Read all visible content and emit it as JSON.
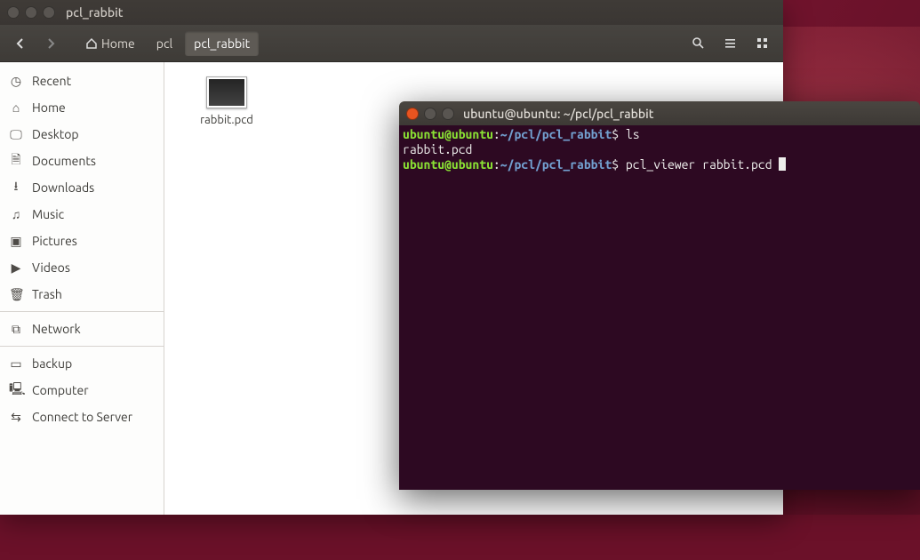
{
  "file_manager": {
    "window_title": "pcl_rabbit",
    "nav": {
      "home_label": "Home",
      "crumbs": [
        "pcl",
        "pcl_rabbit"
      ],
      "active_crumb_index": 1
    },
    "sidebar": {
      "items": [
        {
          "label": "Recent",
          "icon": "clock-icon"
        },
        {
          "label": "Home",
          "icon": "home-icon"
        },
        {
          "label": "Desktop",
          "icon": "desktop-icon"
        },
        {
          "label": "Documents",
          "icon": "document-icon"
        },
        {
          "label": "Downloads",
          "icon": "download-icon"
        },
        {
          "label": "Music",
          "icon": "music-icon"
        },
        {
          "label": "Pictures",
          "icon": "camera-icon"
        },
        {
          "label": "Videos",
          "icon": "video-icon"
        },
        {
          "label": "Trash",
          "icon": "trash-icon"
        }
      ],
      "items2": [
        {
          "label": "Network",
          "icon": "network-icon"
        }
      ],
      "items3": [
        {
          "label": "backup",
          "icon": "drive-icon"
        },
        {
          "label": "Computer",
          "icon": "computer-icon"
        },
        {
          "label": "Connect to Server",
          "icon": "server-icon"
        }
      ]
    },
    "files": [
      {
        "name": "rabbit.pcd"
      }
    ]
  },
  "terminal": {
    "window_title": "ubuntu@ubuntu: ~/pcl/pcl_rabbit",
    "prompt_user": "ubuntu@ubuntu",
    "prompt_path": "~/pcl/pcl_rabbit",
    "prompt_sep": ":",
    "prompt_end": "$",
    "lines": {
      "l0_cmd": "ls",
      "l1_out": "rabbit.pcd",
      "l2_cmd": "pcl_viewer rabbit.pcd "
    }
  }
}
